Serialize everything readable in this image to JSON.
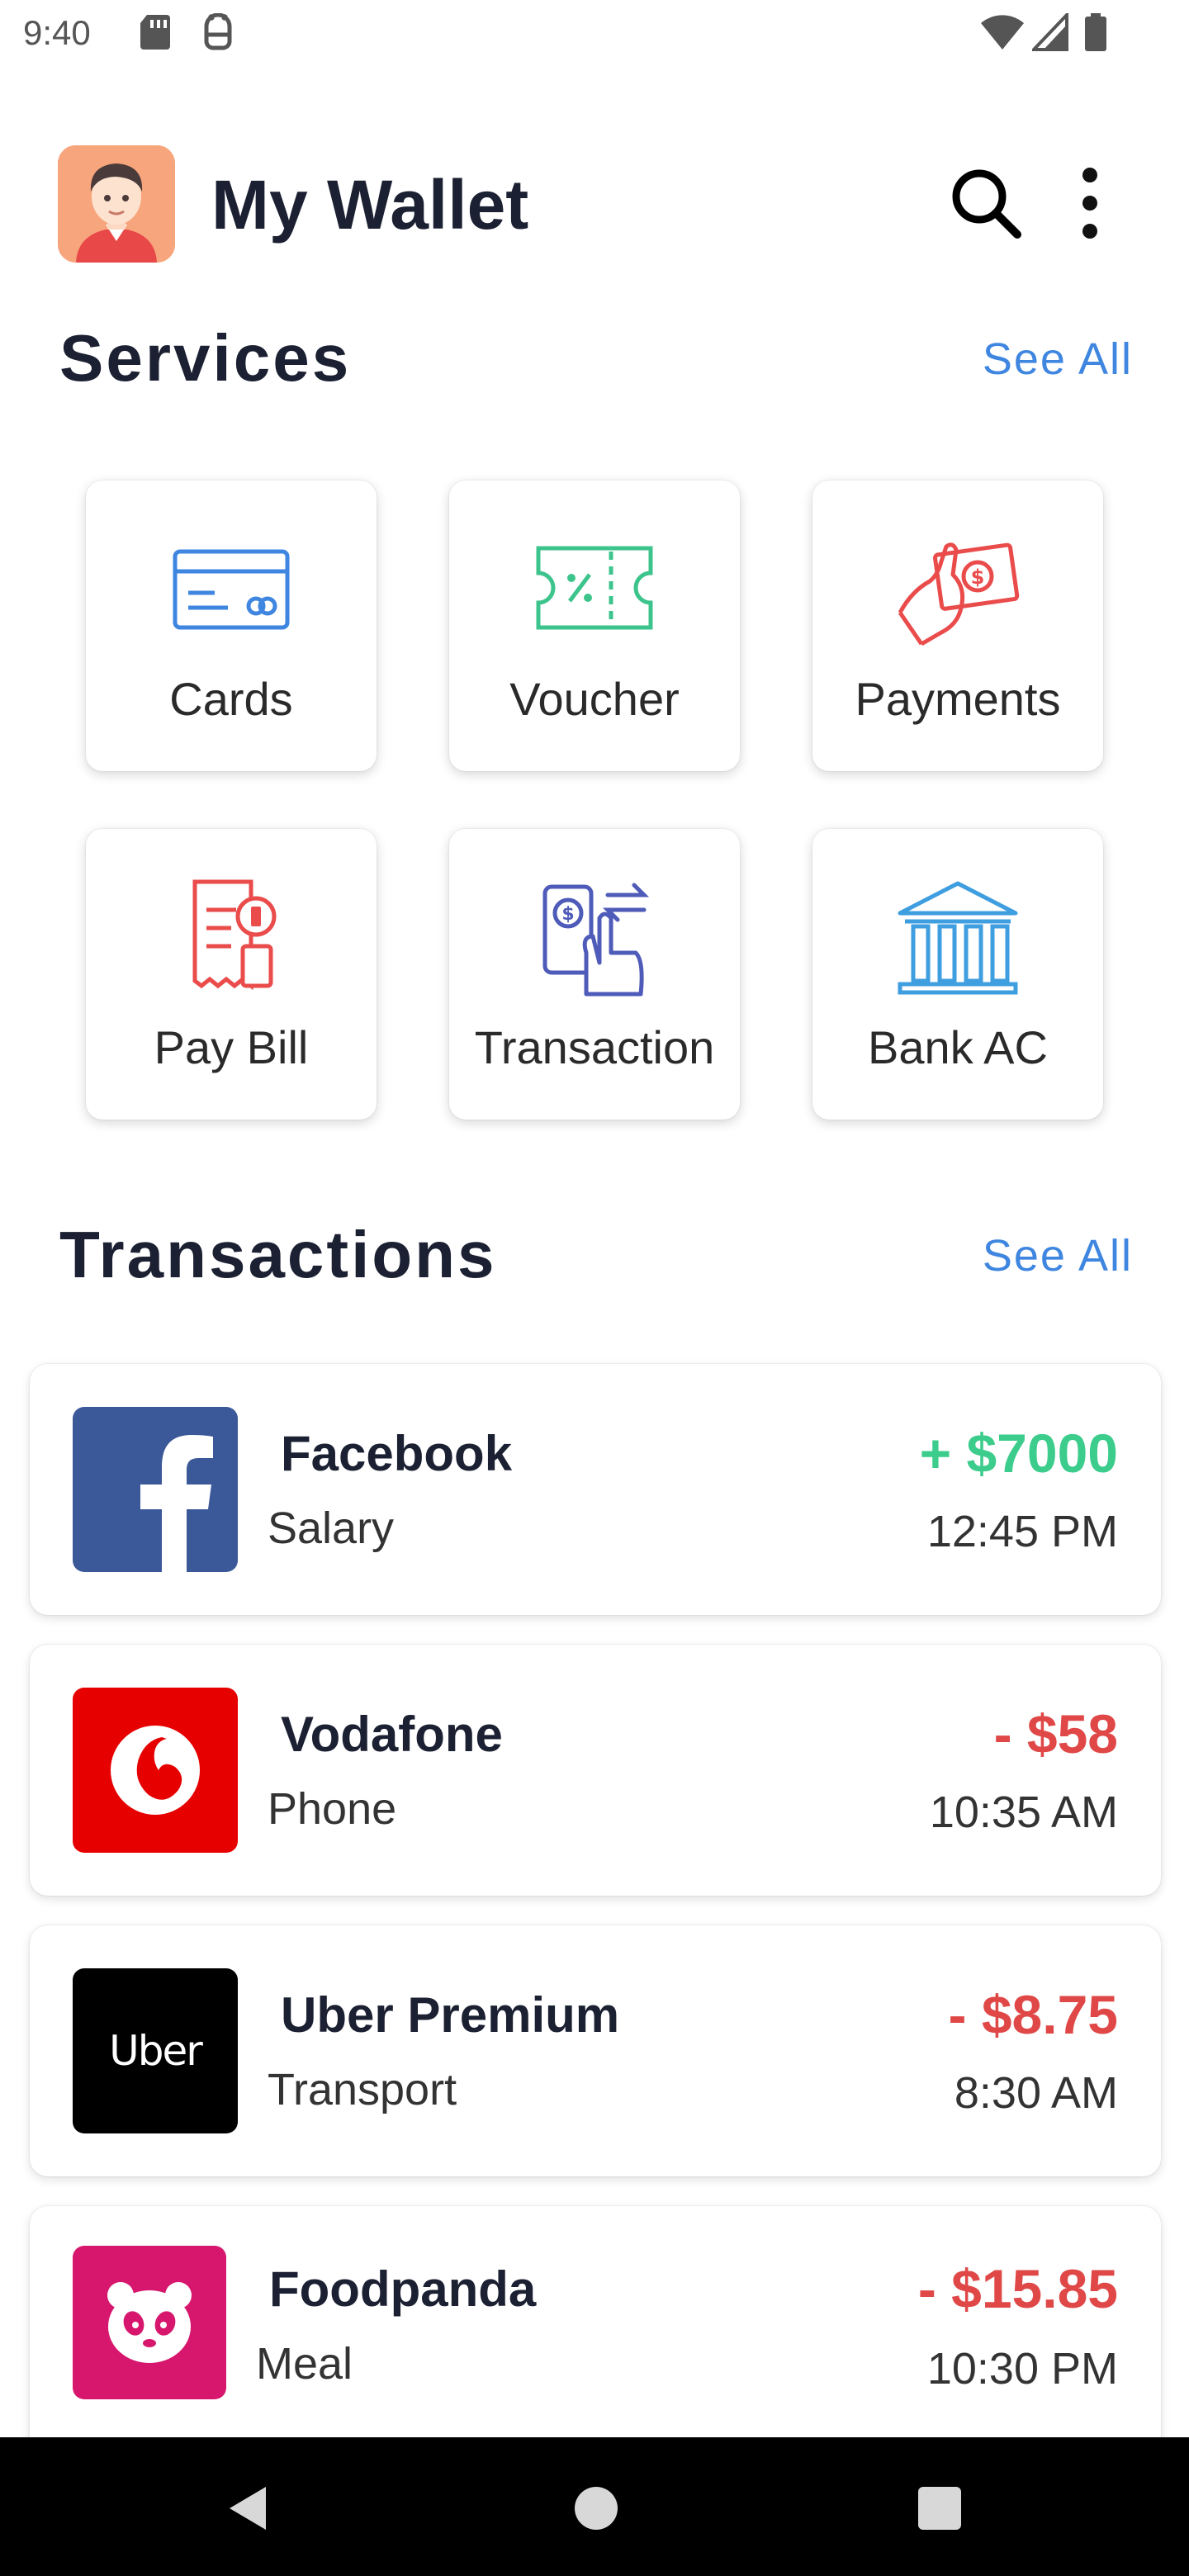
{
  "status_bar": {
    "time": "9:40",
    "icons": [
      "sd-card-icon",
      "android-debug-icon",
      "wifi-icon",
      "signal-icon",
      "battery-icon"
    ]
  },
  "app_bar": {
    "title": "My Wallet",
    "avatar_icon": "user-avatar-icon",
    "actions": [
      "search-icon",
      "more-vert-icon"
    ]
  },
  "services": {
    "title": "Services",
    "see_all": "See All",
    "items": [
      {
        "label": "Cards",
        "icon": "credit-card-icon",
        "color": "#3f86e0"
      },
      {
        "label": "Voucher",
        "icon": "voucher-ticket-icon",
        "color": "#3cc48c"
      },
      {
        "label": "Payments",
        "icon": "hand-cash-icon",
        "color": "#ea4b4b"
      },
      {
        "label": "Pay Bill",
        "icon": "bill-document-icon",
        "color": "#ea4b4b"
      },
      {
        "label": "Transaction",
        "icon": "transfer-hand-icon",
        "color": "#4f5bb8"
      },
      {
        "label": "Bank AC",
        "icon": "bank-building-icon",
        "color": "#3f9ee0"
      }
    ]
  },
  "transactions": {
    "title": "Transactions",
    "see_all": "See All",
    "items": [
      {
        "name": "Facebook",
        "category": "Salary",
        "amount": "+ $7000",
        "time": "12:45 PM",
        "logo": "facebook-logo-icon",
        "amount_color": "#3ccc8c"
      },
      {
        "name": "Vodafone",
        "category": "Phone",
        "amount": "- $58",
        "time": "10:35 AM",
        "logo": "vodafone-logo-icon",
        "amount_color": "#e04848"
      },
      {
        "name": "Uber Premium",
        "category": "Transport",
        "amount": "- $8.75",
        "time": "8:30 AM",
        "logo": "uber-logo-icon",
        "logo_text": "Uber",
        "amount_color": "#e04848"
      },
      {
        "name": "Foodpanda",
        "category": "Meal",
        "amount": "- $15.85",
        "time": "10:30 PM",
        "logo": "foodpanda-logo-icon",
        "amount_color": "#e04848"
      }
    ]
  },
  "nav_bar": {
    "buttons": [
      "back-icon",
      "home-icon",
      "recents-icon"
    ]
  },
  "colors": {
    "accent": "#3f86e0",
    "income": "#3ccc8c",
    "expense": "#e04848",
    "heading": "#1b2032"
  }
}
